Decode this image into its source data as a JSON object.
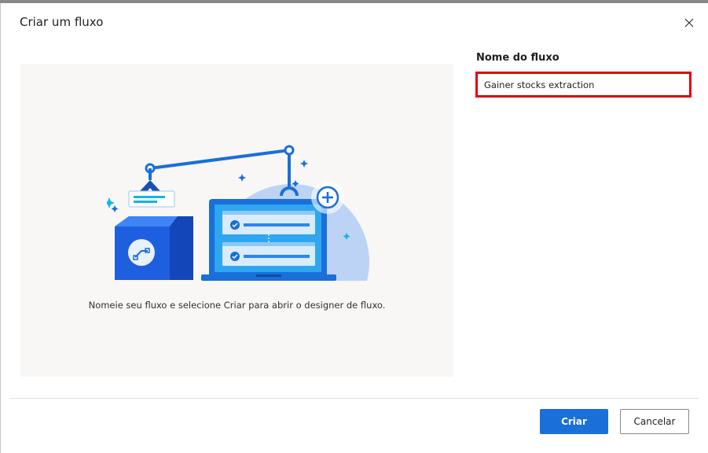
{
  "dialog": {
    "title": "Criar um fluxo",
    "close_icon": "close-icon"
  },
  "illustration": {
    "caption": "Nomeie seu fluxo e selecione Criar para abrir o designer de fluxo.",
    "icon": "flow-designer-illustration"
  },
  "form": {
    "name_label": "Nome do fluxo",
    "name_value": "Gainer stocks extraction",
    "highlight_color": "#e3000f"
  },
  "footer": {
    "create_label": "Criar",
    "cancel_label": "Cancelar"
  },
  "colors": {
    "primary": "#1a6fd8",
    "panel_bg": "#f8f7f6"
  }
}
